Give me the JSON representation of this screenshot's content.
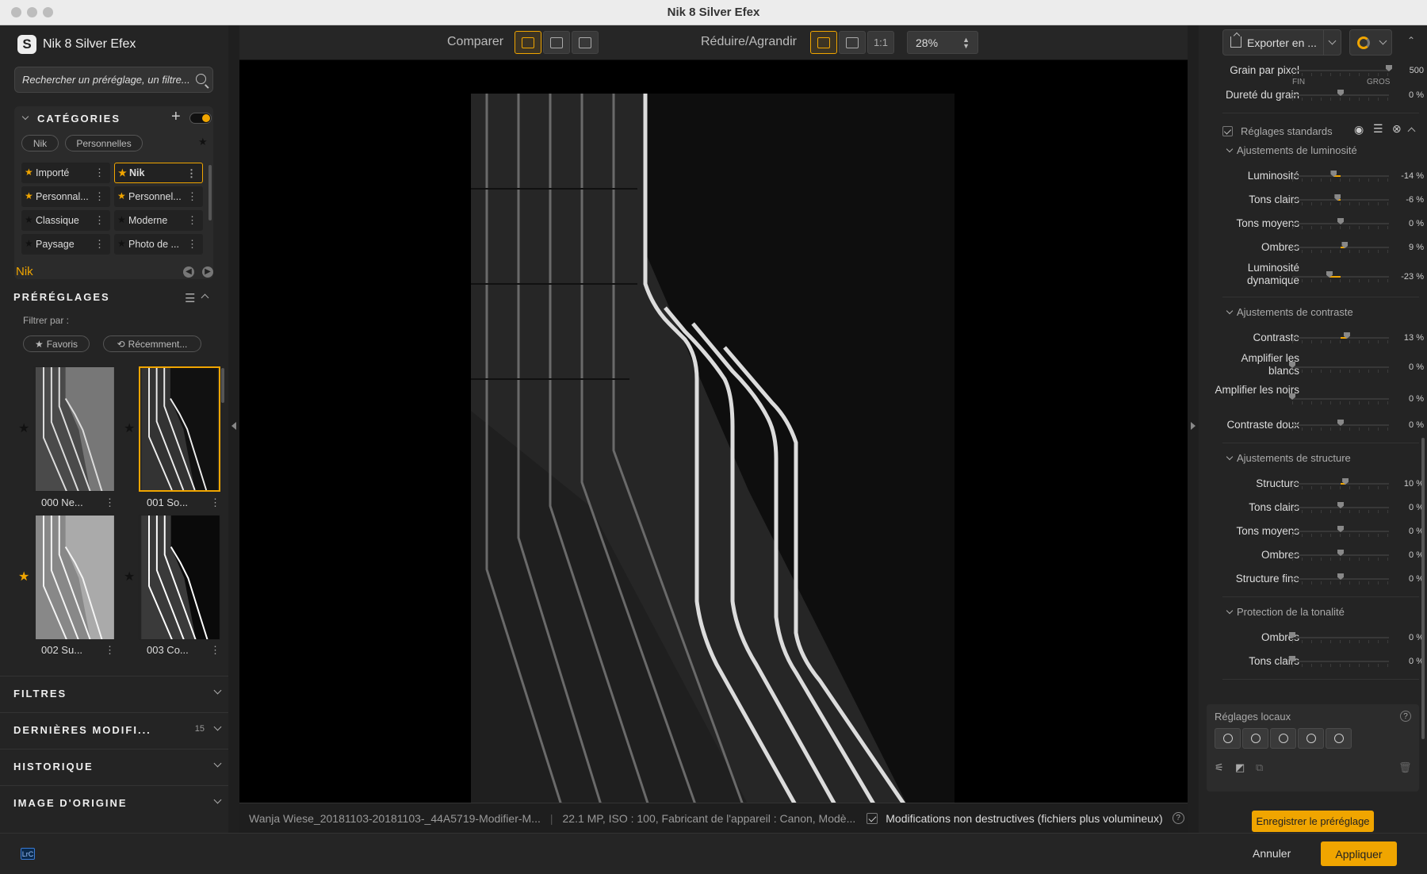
{
  "window": {
    "title": "Nik 8 Silver Efex"
  },
  "left": {
    "brand": "Nik 8 Silver Efex",
    "search_placeholder": "Rechercher un préréglage, un filtre...",
    "categories": {
      "title": "CATÉGORIES",
      "tags": [
        "Nik",
        "Personnelles"
      ],
      "items": [
        {
          "label": "Importé",
          "star": "gold"
        },
        {
          "label": "Nik",
          "star": "gold",
          "selected": true
        },
        {
          "label": "Personnal...",
          "star": "gold"
        },
        {
          "label": "Personnel...",
          "star": "gold"
        },
        {
          "label": "Classique",
          "star": "dark"
        },
        {
          "label": "Moderne",
          "star": "dark"
        },
        {
          "label": "Paysage",
          "star": "dark"
        },
        {
          "label": "Photo de ...",
          "star": "dark"
        }
      ]
    },
    "current_category": "Nik",
    "presets": {
      "title": "PRÉRÉGLAGES",
      "filter_label": "Filtrer par :",
      "filters": [
        "Favoris",
        "Récemment..."
      ],
      "thumbs": [
        {
          "label": "000 Ne...",
          "fav": false
        },
        {
          "label": "001 So...",
          "fav": false,
          "selected": true
        },
        {
          "label": "002 Su...",
          "fav": true
        },
        {
          "label": "003 Co...",
          "fav": false
        }
      ]
    },
    "sections": [
      {
        "label": "FILTRES",
        "badge": ""
      },
      {
        "label": "DERNIÈRES MODIFI...",
        "badge": "15"
      },
      {
        "label": "HISTORIQUE",
        "badge": ""
      },
      {
        "label": "IMAGE D'ORIGINE",
        "badge": ""
      }
    ]
  },
  "toolbar": {
    "compare_label": "Comparer",
    "zoom_label": "Réduire/Agrandir",
    "one_to_one": "1:1",
    "zoom_value": "28%"
  },
  "status": {
    "filename": "Wanja Wiese_20181103-20181103-_44A5719-Modifier-M...",
    "meta": "22.1 MP, ISO : 100, Fabricant de l'appareil : Canon, Modè...",
    "nondestructive": "Modifications non destructives (fichiers plus volumineux)",
    "help": "?"
  },
  "right": {
    "export_label": "Exporter en ...",
    "grain": {
      "label": "Grain par pixel",
      "value": "500",
      "min_label": "FIN",
      "max_label": "GROS",
      "knob": 1.0
    },
    "hardness": {
      "label": "Dureté du grain",
      "value": "0 %",
      "knob": 0.5
    },
    "std_label": "Réglages standards",
    "groups": [
      {
        "title": "Ajustements de luminosité",
        "rows": [
          {
            "label": "Luminosité",
            "value": "-14 %",
            "level": -0.14
          },
          {
            "label": "Tons clairs",
            "value": "-6 %",
            "level": -0.06
          },
          {
            "label": "Tons moyens",
            "value": "0 %",
            "level": 0
          },
          {
            "label": "Ombres",
            "value": "9 %",
            "level": 0.09
          },
          {
            "label": "Luminosité dynamique",
            "value": "-23 %",
            "level": -0.23,
            "two": true
          }
        ]
      },
      {
        "title": "Ajustements de contraste",
        "rows": [
          {
            "label": "Contraste",
            "value": "13 %",
            "level": 0.13
          },
          {
            "label": "Amplifier les blancs",
            "value": "0 %",
            "level": 0,
            "two": true,
            "left": true
          },
          {
            "label": "Amplifier les noirs",
            "value": "0 %",
            "level": 0,
            "two": true,
            "left": true
          },
          {
            "label": "Contraste doux",
            "value": "0 %",
            "level": 0
          }
        ]
      },
      {
        "title": "Ajustements de structure",
        "rows": [
          {
            "label": "Structure",
            "value": "10 %",
            "level": 0.1
          },
          {
            "label": "Tons clairs",
            "value": "0 %",
            "level": 0
          },
          {
            "label": "Tons moyens",
            "value": "0 %",
            "level": 0
          },
          {
            "label": "Ombres",
            "value": "0 %",
            "level": 0
          },
          {
            "label": "Structure fine",
            "value": "0 %",
            "level": 0
          }
        ]
      },
      {
        "title": "Protection de la tonalité",
        "rows": [
          {
            "label": "Ombres",
            "value": "0 %",
            "level": 0,
            "left": true
          },
          {
            "label": "Tons clairs",
            "value": "0 %",
            "level": 0,
            "left": true
          }
        ]
      }
    ],
    "local_label": "Réglages locaux",
    "save_preset": "Enregistrer le préréglage"
  },
  "bottom": {
    "lrc": "LrC",
    "cancel": "Annuler",
    "apply": "Appliquer"
  },
  "colors": {
    "accent": "#f0a500",
    "panel": "#242424",
    "canvas": "#000000"
  }
}
